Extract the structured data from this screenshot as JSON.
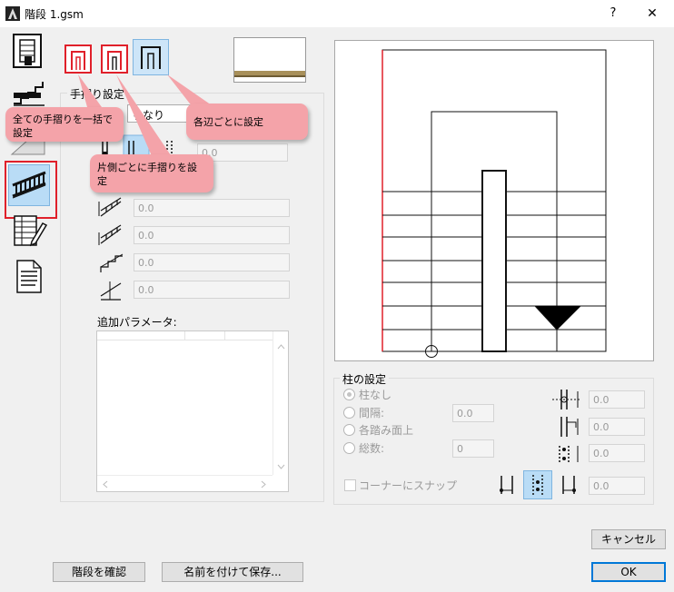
{
  "window": {
    "title": "階段 1.gsm",
    "help": "?",
    "close": "✕"
  },
  "railing": {
    "group_title": "手摺り設定",
    "dropdown_fragment": "りなり",
    "fields": [
      "0.0",
      "0.0",
      "0.0",
      "0.0",
      "0.0"
    ],
    "field_partial": "0.0",
    "add_param_label": "追加パラメータ:"
  },
  "callouts": {
    "all": "全ての手摺りを一括で設定",
    "each_side": "片側ごとに手摺りを設定",
    "each_edge": "各辺ごとに設定"
  },
  "columns": {
    "group_title": "柱の設定",
    "options": [
      "柱なし",
      "間隔:",
      "各踏み面上",
      "総数:"
    ],
    "spacing_value": "0.0",
    "count_value": "0",
    "right_values": [
      "0.0",
      "0.0",
      "0.0"
    ],
    "snap_label": "コーナーにスナップ",
    "snap_value": "0.0"
  },
  "buttons": {
    "cancel": "キャンセル",
    "ok": "OK",
    "check_stair": "階段を確認",
    "save_as": "名前を付けて保存..."
  },
  "colors": {
    "highlight_red": "#e0202a",
    "callout": "#f4a3a9",
    "selected": "#b9dcf6"
  }
}
